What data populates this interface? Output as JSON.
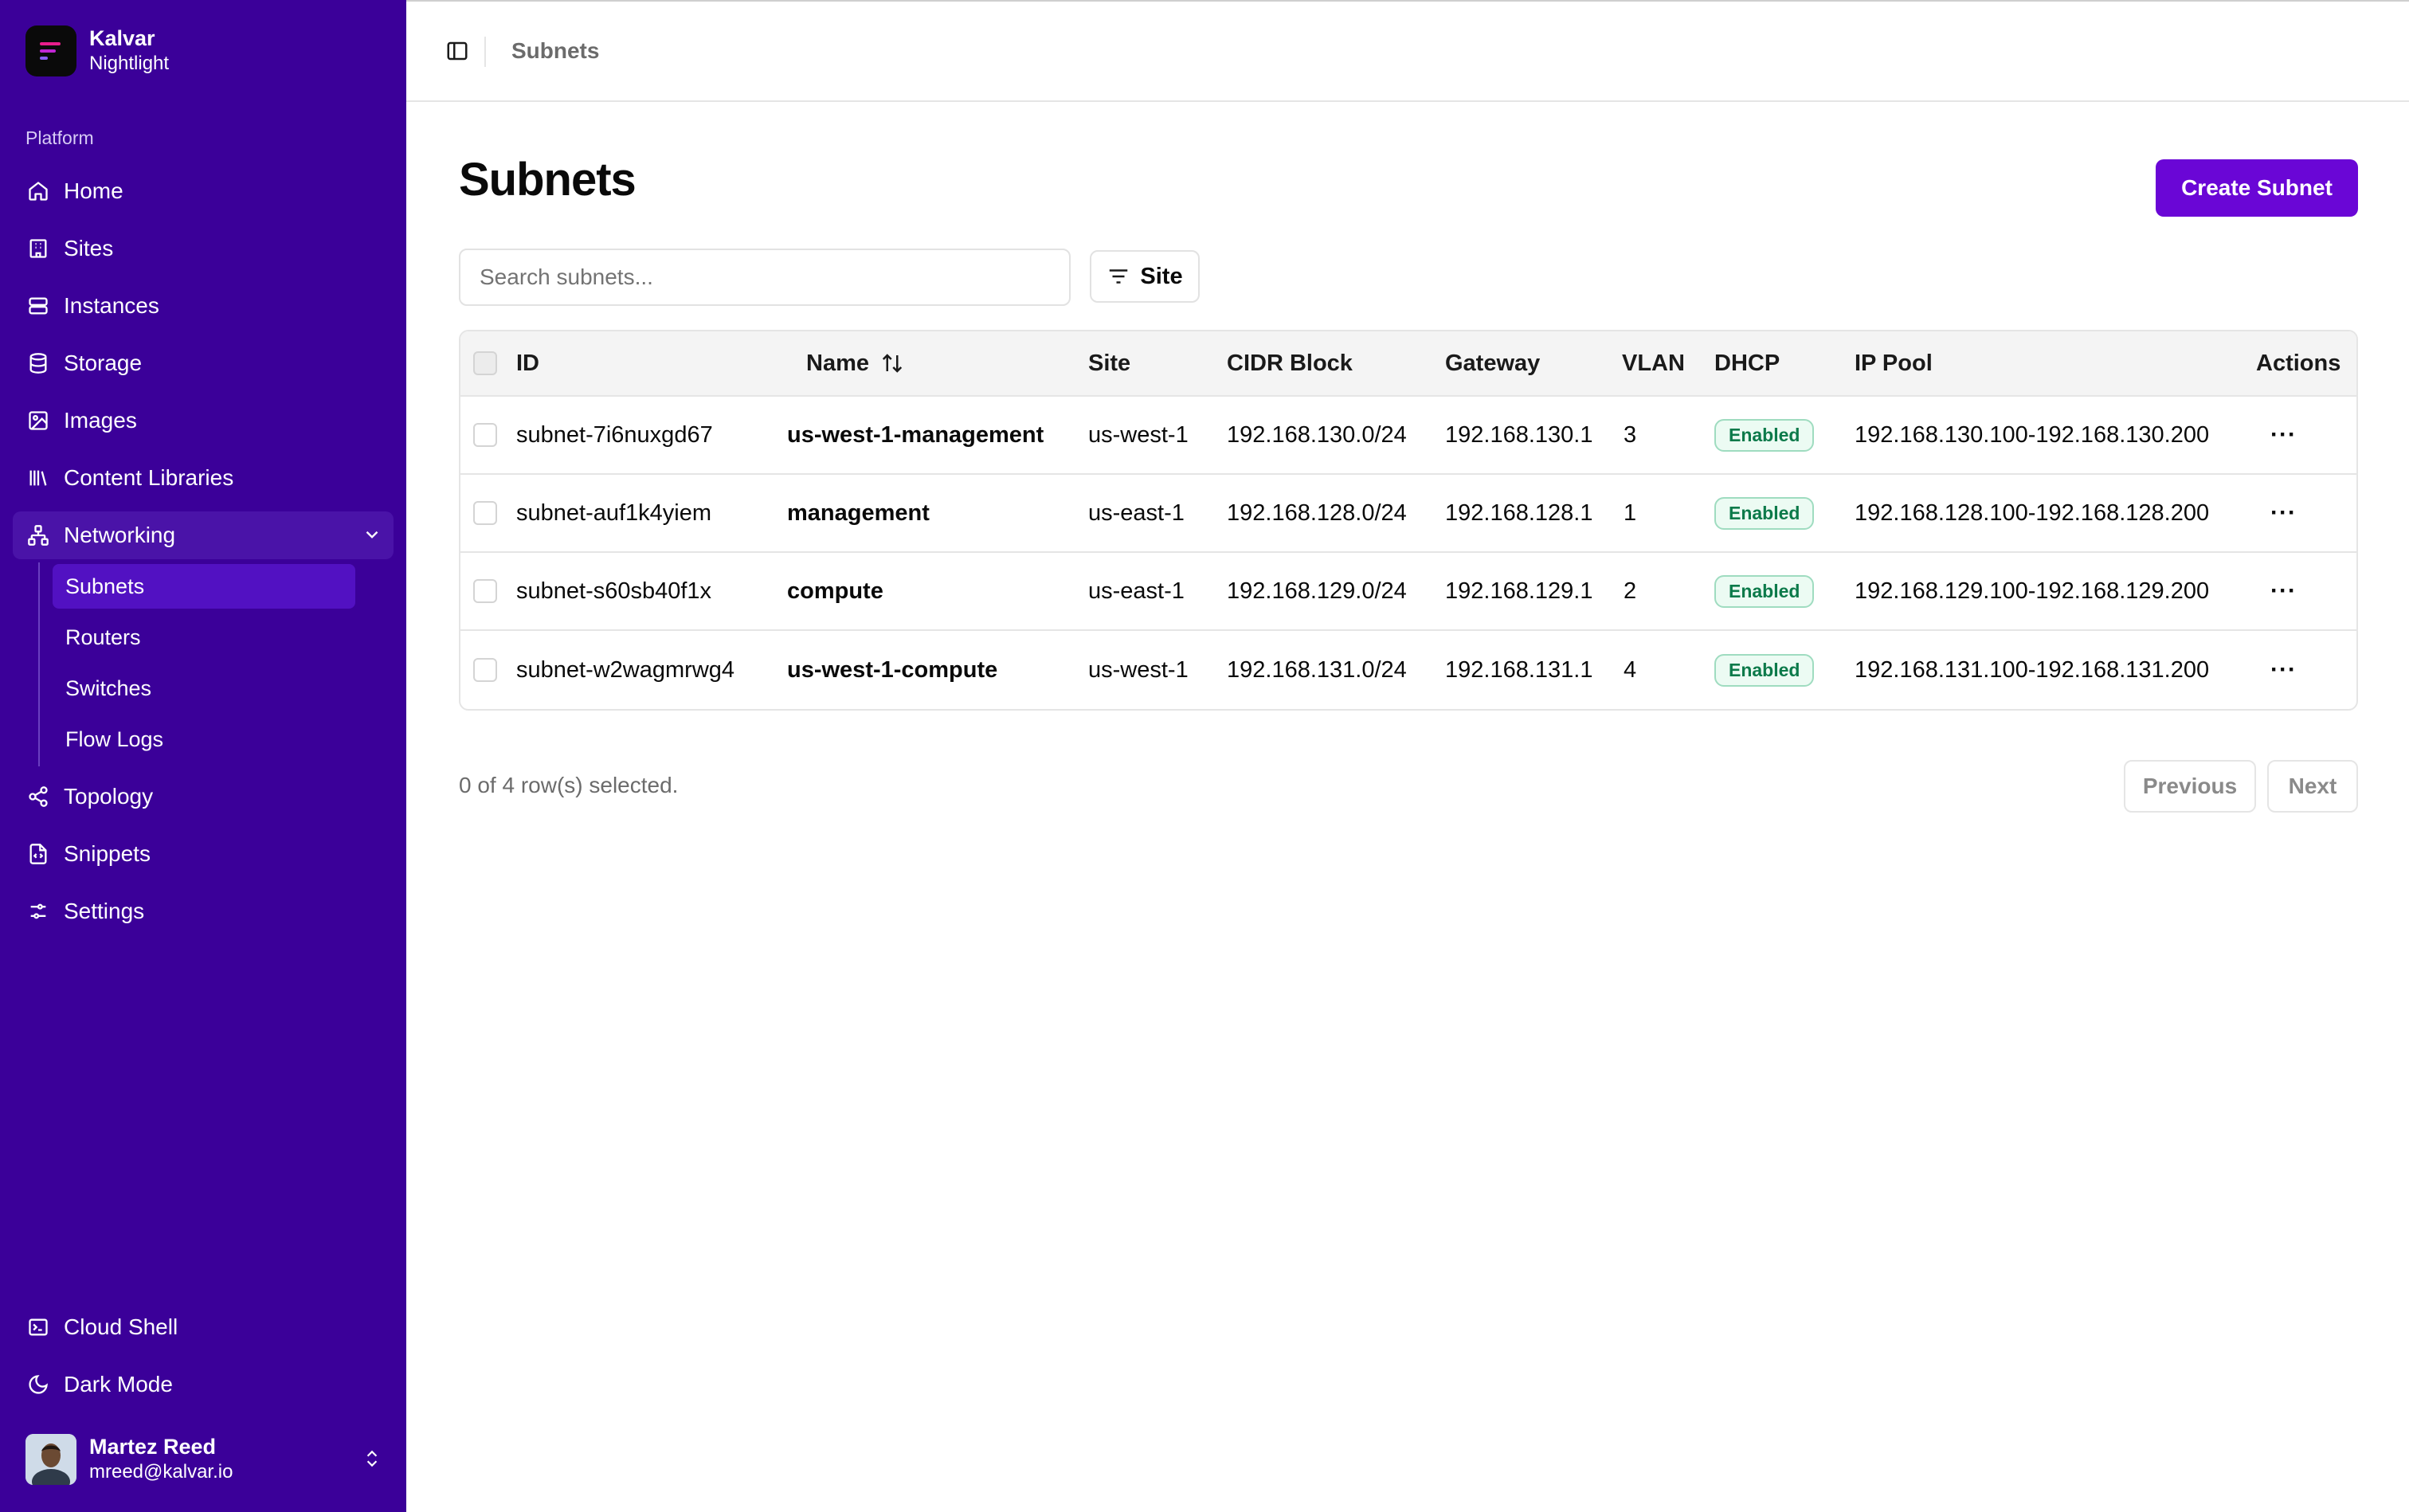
{
  "brand": {
    "name": "Kalvar",
    "subtitle": "Nightlight"
  },
  "sidebar": {
    "section_label": "Platform",
    "items": [
      {
        "label": "Home",
        "icon": "home-icon"
      },
      {
        "label": "Sites",
        "icon": "building-icon"
      },
      {
        "label": "Instances",
        "icon": "server-icon"
      },
      {
        "label": "Storage",
        "icon": "database-icon"
      },
      {
        "label": "Images",
        "icon": "image-icon"
      },
      {
        "label": "Content Libraries",
        "icon": "library-icon"
      },
      {
        "label": "Networking",
        "icon": "network-icon",
        "expanded": true
      },
      {
        "label": "Topology",
        "icon": "share-icon"
      },
      {
        "label": "Snippets",
        "icon": "code-file-icon"
      },
      {
        "label": "Settings",
        "icon": "sliders-icon"
      }
    ],
    "networking_children": [
      {
        "label": "Subnets",
        "active": true
      },
      {
        "label": "Routers"
      },
      {
        "label": "Switches"
      },
      {
        "label": "Flow Logs"
      }
    ],
    "bottom_items": [
      {
        "label": "Cloud Shell",
        "icon": "terminal-icon"
      },
      {
        "label": "Dark Mode",
        "icon": "moon-icon"
      }
    ],
    "user": {
      "name": "Martez Reed",
      "email": "mreed@kalvar.io"
    }
  },
  "header": {
    "breadcrumb": "Subnets"
  },
  "main": {
    "title": "Subnets",
    "create_button": "Create Subnet",
    "search_placeholder": "Search subnets...",
    "filter_label": "Site",
    "columns": [
      "ID",
      "Name",
      "Site",
      "CIDR Block",
      "Gateway",
      "VLAN",
      "DHCP",
      "IP Pool",
      "Actions"
    ],
    "rows": [
      {
        "id": "subnet-7i6nuxgd67",
        "name": "us-west-1-management",
        "site": "us-west-1",
        "cidr": "192.168.130.0/24",
        "gateway": "192.168.130.1",
        "vlan": "3",
        "dhcp": "Enabled",
        "pool": "192.168.130.100-192.168.130.200"
      },
      {
        "id": "subnet-auf1k4yiem",
        "name": "management",
        "site": "us-east-1",
        "cidr": "192.168.128.0/24",
        "gateway": "192.168.128.1",
        "vlan": "1",
        "dhcp": "Enabled",
        "pool": "192.168.128.100-192.168.128.200"
      },
      {
        "id": "subnet-s60sb40f1x",
        "name": "compute",
        "site": "us-east-1",
        "cidr": "192.168.129.0/24",
        "gateway": "192.168.129.1",
        "vlan": "2",
        "dhcp": "Enabled",
        "pool": "192.168.129.100-192.168.129.200"
      },
      {
        "id": "subnet-w2wagmrwg4",
        "name": "us-west-1-compute",
        "site": "us-west-1",
        "cidr": "192.168.131.0/24",
        "gateway": "192.168.131.1",
        "vlan": "4",
        "dhcp": "Enabled",
        "pool": "192.168.131.100-192.168.131.200"
      }
    ],
    "actions_glyph": "···",
    "selected_text": "0 of 4 row(s) selected.",
    "previous_label": "Previous",
    "next_label": "Next"
  },
  "colors": {
    "sidebar_bg": "#3b0099",
    "accent": "#6a06d6",
    "badge_green": "#0c7a4a"
  }
}
